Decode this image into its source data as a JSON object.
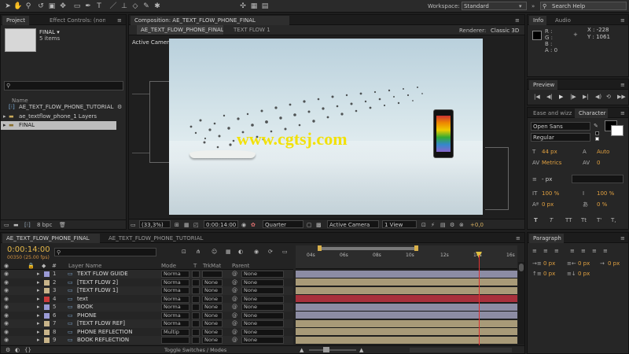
{
  "toolbar": {
    "workspace_label": "Workspace:",
    "workspace_value": "Standard",
    "search_placeholder": "Search Help"
  },
  "project": {
    "tab_project": "Project",
    "tab_effects": "Effect Controls: (none)",
    "item_name": "FINAL ▾",
    "item_count": "5 items",
    "column_name": "Name",
    "items": [
      {
        "label": "AE_TEXT_FLOW_PHONE_TUTORIAL"
      },
      {
        "label": "ae_textflow_phone_1 Layers"
      },
      {
        "label": "FINAL"
      }
    ],
    "bpc": "8 bpc"
  },
  "composition": {
    "tab_title": "Composition: AE_TEXT_FLOW_PHONE_FINAL",
    "subtab_active": "AE_TEXT_FLOW_PHONE_FINAL",
    "subtab_other": "TEXT FLOW 1",
    "renderer_label": "Renderer:",
    "renderer_value": "Classic 3D",
    "view_label": "Active Camera",
    "watermark": "www.cgtsj.com",
    "zoom": "(33,3%)",
    "timecode": "0:00:14:00",
    "resolution": "Quarter",
    "camera": "Active Camera",
    "views": "1 View",
    "exposure": "+0,0"
  },
  "info": {
    "tab_info": "Info",
    "tab_audio": "Audio",
    "r": "R :",
    "g": "G :",
    "b": "B :",
    "a": "A : 0",
    "x": "X : -228",
    "y": "Y : 1061"
  },
  "preview": {
    "tab": "Preview"
  },
  "character": {
    "tab_ease": "Ease and wizz",
    "tab_char": "Character",
    "font": "Open Sans",
    "style": "Regular",
    "size": "44 px",
    "leading": "Auto",
    "kerning": "Metrics",
    "tracking": "0",
    "stroke_width": "- px",
    "vscale": "100 %",
    "hscale": "100 %",
    "baseline": "0 px",
    "tsume": "0 %",
    "style_buttons": [
      "T",
      "T",
      "TT",
      "Tt",
      "T'",
      "T,"
    ]
  },
  "paragraph": {
    "tab": "Paragraph",
    "indent_values": [
      "0 px",
      "0 px",
      "0 px",
      "0 px",
      "0 px"
    ]
  },
  "timeline": {
    "tab_active": "AE_TEXT_FLOW_PHONE_FINAL",
    "tab_other": "AE_TEXT_FLOW_PHONE_TUTORIAL",
    "timecode": "0:00:14:00",
    "frames": "00350 (25.00 fps)",
    "col_layer_name": "Layer Name",
    "col_mode": "Mode",
    "col_t": "T",
    "col_trkmat": "TrkMat",
    "col_parent": "Parent",
    "ruler": [
      "04s",
      "06s",
      "08s",
      "10s",
      "12s",
      "14s",
      "16s"
    ],
    "toggle_label": "Toggle Switches / Modes",
    "layers": [
      {
        "num": "1",
        "name": "TEXT FLOW GUIDE",
        "mode": "Norma",
        "trkmat": "",
        "parent": "None",
        "color": "#9b9bd6",
        "bar": "#8c8ca4"
      },
      {
        "num": "2",
        "name": "[TEXT FLOW 2]",
        "mode": "Norma",
        "trkmat": "None",
        "parent": "None",
        "color": "#c8b48a",
        "bar": "#a89a78"
      },
      {
        "num": "3",
        "name": "[TEXT FLOW 1]",
        "mode": "Norma",
        "trkmat": "None",
        "parent": "None",
        "color": "#c8b48a",
        "bar": "#a89a78"
      },
      {
        "num": "4",
        "name": "text",
        "mode": "Norma",
        "trkmat": "None",
        "parent": "None",
        "color": "#cc3a3a",
        "bar": "#a8303c"
      },
      {
        "num": "5",
        "name": "BOOK",
        "mode": "Norma",
        "trkmat": "None",
        "parent": "None",
        "color": "#9b9bd6",
        "bar": "#8c8ca4"
      },
      {
        "num": "6",
        "name": "PHONE",
        "mode": "Norma",
        "trkmat": "None",
        "parent": "None",
        "color": "#9b9bd6",
        "bar": "#8c8ca4"
      },
      {
        "num": "7",
        "name": "[TEXT FLOW REF]",
        "mode": "Norma",
        "trkmat": "None",
        "parent": "None",
        "color": "#c8b48a",
        "bar": "#a89a78"
      },
      {
        "num": "8",
        "name": "PHONE REFLECTION",
        "mode": "Multip",
        "trkmat": "None",
        "parent": "None",
        "color": "#c8b48a",
        "bar": "#a89a78"
      },
      {
        "num": "9",
        "name": "BOOK REFLECTION",
        "mode": "",
        "trkmat": "None",
        "parent": "None",
        "color": "#c8b48a",
        "bar": "#a89a78"
      }
    ]
  }
}
